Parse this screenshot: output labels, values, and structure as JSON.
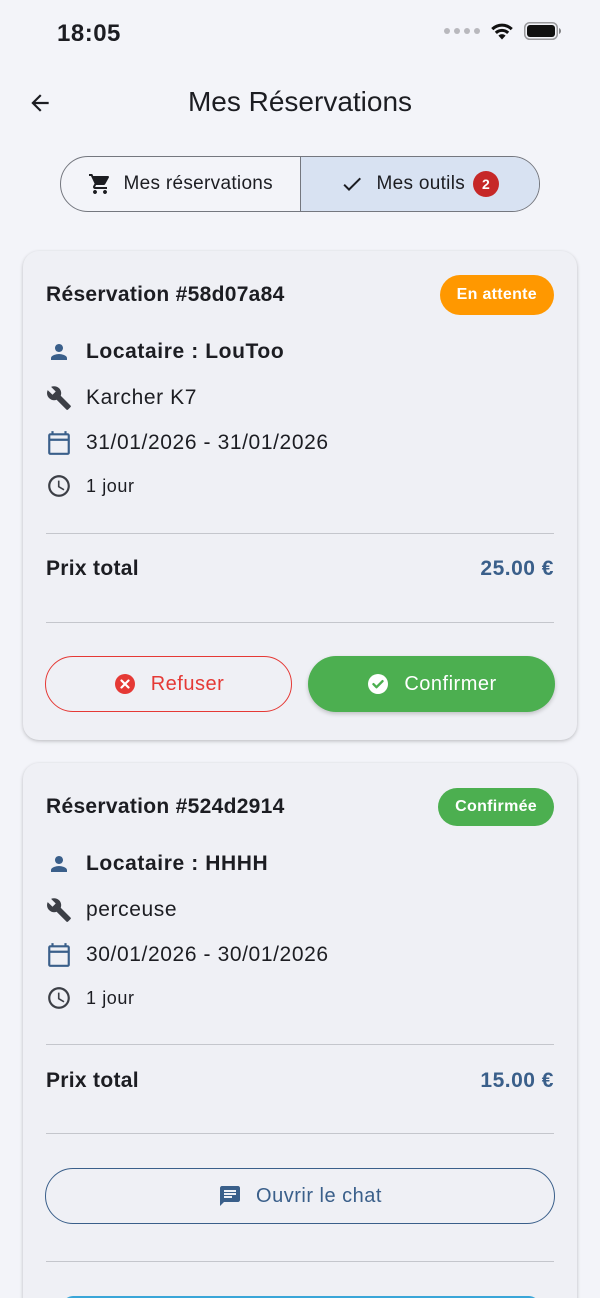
{
  "status_bar": {
    "time": "18:05"
  },
  "header": {
    "title": "Mes Réservations"
  },
  "tabs": [
    {
      "label": "Mes réservations",
      "icon": "cart-icon",
      "selected": false
    },
    {
      "label": "Mes outils",
      "icon": "check-icon",
      "selected": true,
      "badge": "2"
    }
  ],
  "reservations": [
    {
      "title": "Réservation #58d07a84",
      "status": "En attente",
      "status_color": "#ff9800",
      "tenant": "Locataire : LouToo",
      "tool": "Karcher K7",
      "dates": "31/01/2026 - 31/01/2026",
      "duration": "1 jour",
      "price_label": "Prix total",
      "price": "25.00 €",
      "actions": {
        "refuse": "Refuser",
        "confirm": "Confirmer"
      }
    },
    {
      "title": "Réservation #524d2914",
      "status": "Confirmée",
      "status_color": "#4caf50",
      "tenant": "Locataire : HHHH",
      "tool": "perceuse",
      "dates": "30/01/2026 - 30/01/2026",
      "duration": "1 jour",
      "price_label": "Prix total",
      "price": "15.00 €",
      "actions": {
        "chat": "Ouvrir le chat"
      }
    }
  ],
  "colors": {
    "accent": "#3a5f8a",
    "danger": "#e53935",
    "success": "#4caf50",
    "warning": "#ff9800",
    "badge": "#c62828"
  }
}
